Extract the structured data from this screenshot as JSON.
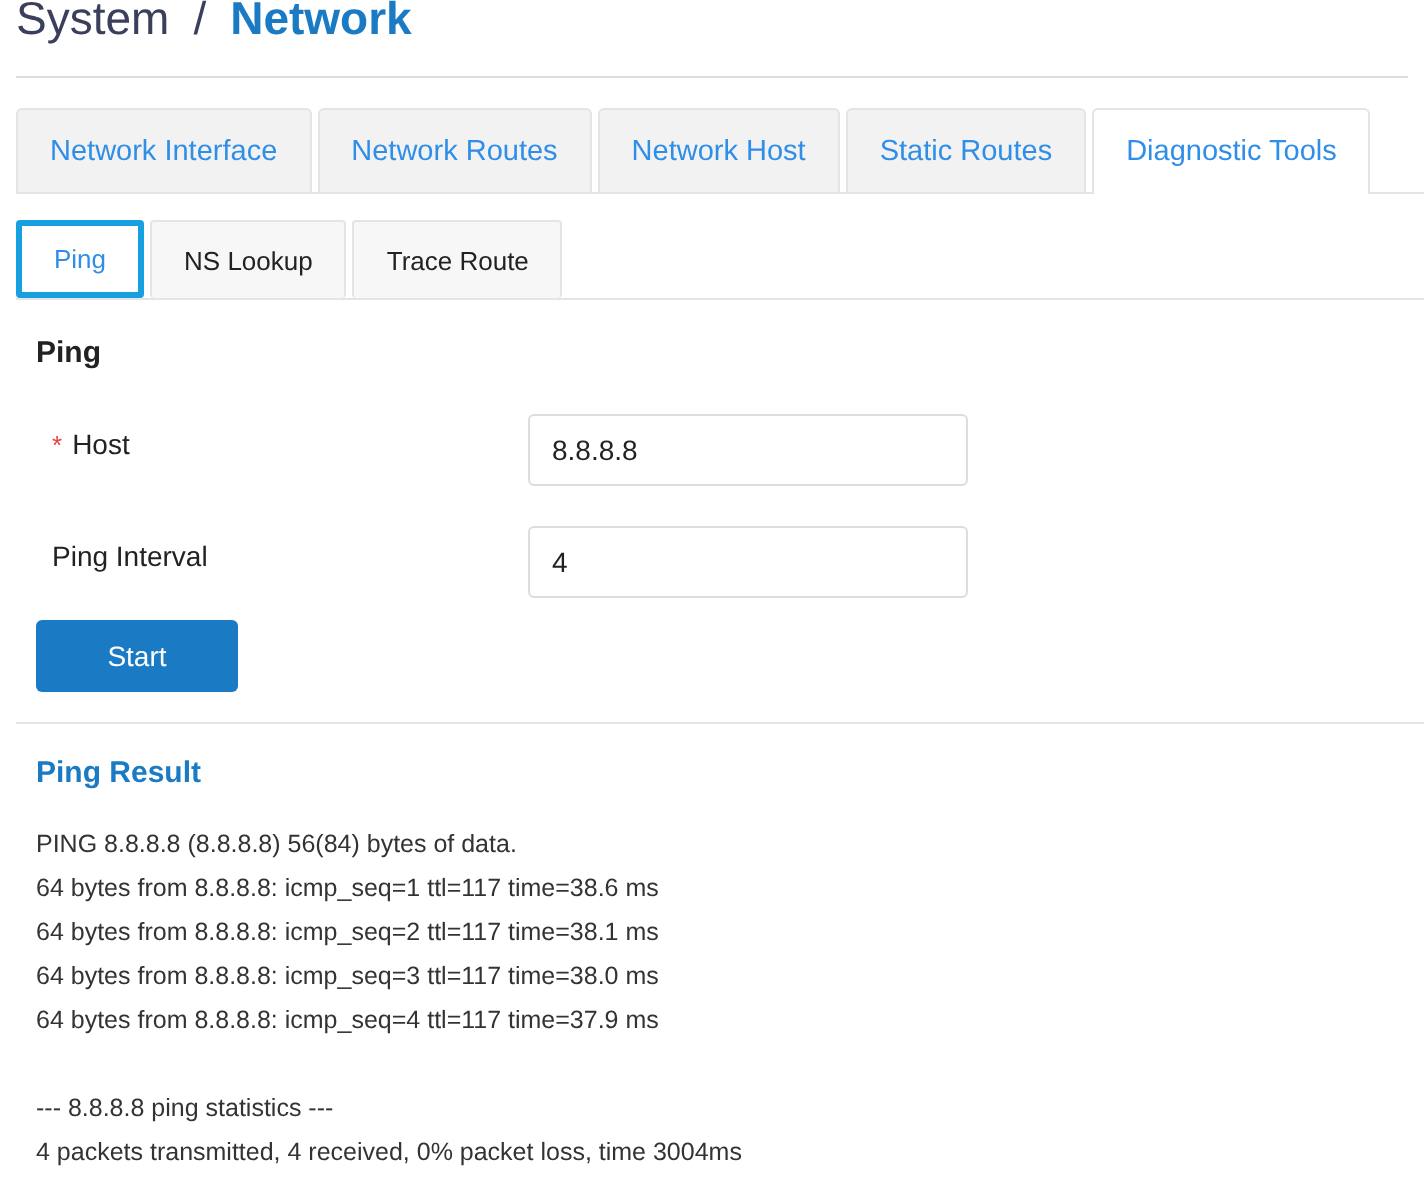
{
  "breadcrumb": {
    "parent": "System",
    "separator": "/",
    "current": "Network"
  },
  "tabs": [
    {
      "label": "Network Interface",
      "selected": false
    },
    {
      "label": "Network Routes",
      "selected": false
    },
    {
      "label": "Network Host",
      "selected": false
    },
    {
      "label": "Static Routes",
      "selected": false
    },
    {
      "label": "Diagnostic Tools",
      "selected": true
    }
  ],
  "subtabs": [
    {
      "label": "Ping",
      "selected": true
    },
    {
      "label": "NS Lookup",
      "selected": false
    },
    {
      "label": "Trace Route",
      "selected": false
    }
  ],
  "form": {
    "title": "Ping",
    "fields": [
      {
        "label": "Host",
        "required": true,
        "value": "8.8.8.8"
      },
      {
        "label": "Ping Interval",
        "required": false,
        "value": "4"
      }
    ],
    "required_mark": "*",
    "button": "Start"
  },
  "result": {
    "title": "Ping Result",
    "output": [
      "PING 8.8.8.8 (8.8.8.8) 56(84) bytes of data.",
      "64 bytes from 8.8.8.8: icmp_seq=1 ttl=117 time=38.6 ms",
      "64 bytes from 8.8.8.8: icmp_seq=2 ttl=117 time=38.1 ms",
      "64 bytes from 8.8.8.8: icmp_seq=3 ttl=117 time=38.0 ms",
      "64 bytes from 8.8.8.8: icmp_seq=4 ttl=117 time=37.9 ms"
    ],
    "statistics": [
      "--- 8.8.8.8 ping statistics ---",
      "4 packets transmitted, 4 received, 0% packet loss, time 3004ms"
    ]
  }
}
